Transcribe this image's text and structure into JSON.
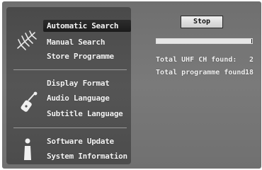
{
  "menu": {
    "group_search": {
      "items": [
        {
          "label": "Automatic Search",
          "selected": true
        },
        {
          "label": "Manual Search"
        },
        {
          "label": "Store Programme"
        }
      ],
      "icon": "antenna-icon"
    },
    "group_language": {
      "items": [
        {
          "label": "Display Format"
        },
        {
          "label": "Audio Language"
        },
        {
          "label": "Subtitle Language"
        }
      ],
      "icon": "pin-icon"
    },
    "group_system": {
      "items": [
        {
          "label": "Software Update"
        },
        {
          "label": "System Information"
        }
      ],
      "icon": "info-icon"
    }
  },
  "search": {
    "stop_label": "Stop",
    "progress": 0.99,
    "uhf_label": "Total UHF CH  found:",
    "uhf_value": "2",
    "programme_label": "Total programme found:",
    "programme_value": "18"
  },
  "colors": {
    "selected_bg": "#1f1f1f",
    "panel_bg": "#505050",
    "screen_bg": "#747474",
    "text": "#f4f4f4"
  }
}
